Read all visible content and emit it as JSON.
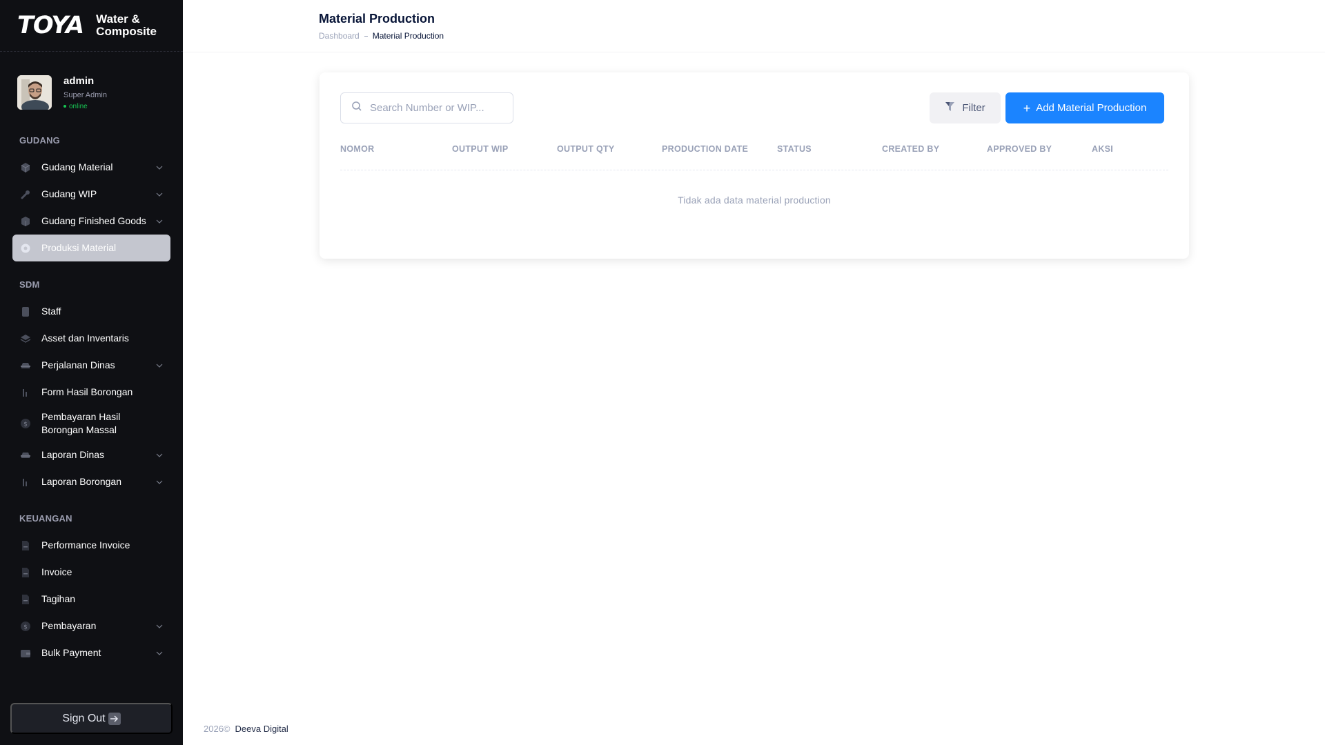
{
  "brand": {
    "logo": "TOYA",
    "line1": "Water &",
    "line2": "Composite"
  },
  "user": {
    "name": "admin",
    "role": "Super Admin",
    "status": "online"
  },
  "sidebar": {
    "sections": [
      {
        "title": "GUDANG",
        "items": [
          {
            "label": "Gudang Material",
            "icon": "cube-icon",
            "has_children": true
          },
          {
            "label": "Gudang WIP",
            "icon": "wrench-icon",
            "has_children": true
          },
          {
            "label": "Gudang Finished Goods",
            "icon": "box-icon",
            "has_children": true
          },
          {
            "label": "Produksi Material",
            "icon": "cog-icon",
            "has_children": false,
            "active": true
          }
        ]
      },
      {
        "title": "SDM",
        "items": [
          {
            "label": "Staff",
            "icon": "user-icon"
          },
          {
            "label": "Asset dan Inventaris",
            "icon": "layers-icon"
          },
          {
            "label": "Perjalanan Dinas",
            "icon": "car-icon",
            "has_children": true
          },
          {
            "label": "Form Hasil Borongan",
            "icon": "chart-icon"
          },
          {
            "label": "Pembayaran Hasil Borongan Massal",
            "icon": "dollar-icon"
          },
          {
            "label": "Laporan Dinas",
            "icon": "car-icon",
            "has_children": true
          },
          {
            "label": "Laporan Borongan",
            "icon": "chart-icon",
            "has_children": true
          }
        ]
      },
      {
        "title": "KEUANGAN",
        "items": [
          {
            "label": "Performance Invoice",
            "icon": "document-icon"
          },
          {
            "label": "Invoice",
            "icon": "document-icon"
          },
          {
            "label": "Tagihan",
            "icon": "document-icon"
          },
          {
            "label": "Pembayaran",
            "icon": "dollar-icon",
            "has_children": true
          },
          {
            "label": "Bulk Payment",
            "icon": "wallet-icon",
            "has_children": true
          }
        ]
      }
    ],
    "signout_label": "Sign Out"
  },
  "header": {
    "title": "Material Production",
    "breadcrumb": [
      "Dashboard",
      "Material Production"
    ]
  },
  "toolbar": {
    "search_placeholder": "Search Number or WIP...",
    "filter_label": "Filter",
    "add_label": "Add Material Production"
  },
  "table": {
    "columns": [
      "NOMOR",
      "OUTPUT WIP",
      "OUTPUT QTY",
      "PRODUCTION DATE",
      "STATUS",
      "CREATED BY",
      "APPROVED BY",
      "AKSI"
    ],
    "empty_message": "Tidak ada data material production"
  },
  "footer": {
    "year": "2026©",
    "company": "Deeva Digital"
  },
  "colors": {
    "accent": "#1b84ff",
    "sidebar_bg": "#0f1014",
    "online": "#17c653"
  }
}
